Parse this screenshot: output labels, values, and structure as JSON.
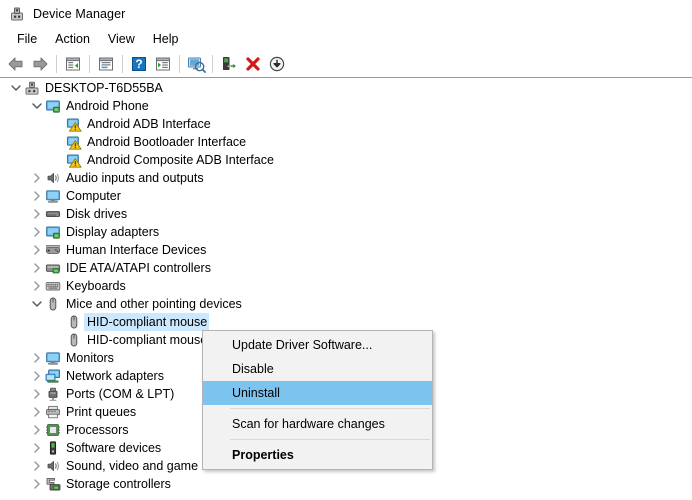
{
  "window": {
    "title": "Device Manager",
    "icon": "device-manager-icon"
  },
  "menubar": {
    "items": [
      {
        "label": "File"
      },
      {
        "label": "Action"
      },
      {
        "label": "View"
      },
      {
        "label": "Help"
      }
    ]
  },
  "toolbar": {
    "buttons": [
      {
        "name": "back-icon",
        "tooltip": "Back"
      },
      {
        "name": "forward-icon",
        "tooltip": "Forward"
      },
      {
        "name": "separator-1"
      },
      {
        "name": "show-hide-console-tree-icon",
        "tooltip": "Show/Hide Console Tree"
      },
      {
        "name": "separator-2"
      },
      {
        "name": "properties-icon",
        "tooltip": "Properties"
      },
      {
        "name": "separator-3"
      },
      {
        "name": "help-icon",
        "tooltip": "Help"
      },
      {
        "name": "view-icon",
        "tooltip": "View"
      },
      {
        "name": "separator-4"
      },
      {
        "name": "scan-for-hardware-changes-icon",
        "tooltip": "Scan for hardware changes"
      },
      {
        "name": "separator-5"
      },
      {
        "name": "update-driver-icon",
        "tooltip": "Update Driver Software"
      },
      {
        "name": "uninstall-icon",
        "tooltip": "Uninstall"
      },
      {
        "name": "disable-icon",
        "tooltip": "Disable"
      }
    ]
  },
  "tree": {
    "rows": [
      {
        "label": "DESKTOP-T6D55BA",
        "indent": 0,
        "state": "expanded",
        "icon": "computer-node-icon",
        "selected": false
      },
      {
        "label": "Android Phone",
        "indent": 1,
        "state": "expanded",
        "icon": "display-adapter-icon",
        "selected": false
      },
      {
        "label": "Android ADB Interface",
        "indent": 2,
        "state": "leaf",
        "icon": "warning-device-icon",
        "selected": false
      },
      {
        "label": "Android Bootloader Interface",
        "indent": 2,
        "state": "leaf",
        "icon": "warning-device-icon",
        "selected": false
      },
      {
        "label": "Android Composite ADB Interface",
        "indent": 2,
        "state": "leaf",
        "icon": "warning-device-icon",
        "selected": false
      },
      {
        "label": "Audio inputs and outputs",
        "indent": 1,
        "state": "collapsed",
        "icon": "speaker-icon",
        "selected": false
      },
      {
        "label": "Computer",
        "indent": 1,
        "state": "collapsed",
        "icon": "monitor-icon",
        "selected": false
      },
      {
        "label": "Disk drives",
        "indent": 1,
        "state": "collapsed",
        "icon": "disk-drive-icon",
        "selected": false
      },
      {
        "label": "Display adapters",
        "indent": 1,
        "state": "collapsed",
        "icon": "display-adapter-icon",
        "selected": false
      },
      {
        "label": "Human Interface Devices",
        "indent": 1,
        "state": "collapsed",
        "icon": "gamepad-icon",
        "selected": false
      },
      {
        "label": "IDE ATA/ATAPI controllers",
        "indent": 1,
        "state": "collapsed",
        "icon": "ide-controller-icon",
        "selected": false
      },
      {
        "label": "Keyboards",
        "indent": 1,
        "state": "collapsed",
        "icon": "keyboard-icon",
        "selected": false
      },
      {
        "label": "Mice and other pointing devices",
        "indent": 1,
        "state": "expanded",
        "icon": "mouse-icon",
        "selected": false
      },
      {
        "label": "HID-compliant mouse",
        "indent": 2,
        "state": "leaf",
        "icon": "mouse-icon",
        "selected": true
      },
      {
        "label": "HID-compliant mouse",
        "indent": 2,
        "state": "leaf",
        "icon": "mouse-icon",
        "selected": false
      },
      {
        "label": "Monitors",
        "indent": 1,
        "state": "collapsed",
        "icon": "monitor-icon",
        "selected": false
      },
      {
        "label": "Network adapters",
        "indent": 1,
        "state": "collapsed",
        "icon": "network-adapter-icon",
        "selected": false
      },
      {
        "label": "Ports (COM & LPT)",
        "indent": 1,
        "state": "collapsed",
        "icon": "port-icon",
        "selected": false
      },
      {
        "label": "Print queues",
        "indent": 1,
        "state": "collapsed",
        "icon": "printer-icon",
        "selected": false
      },
      {
        "label": "Processors",
        "indent": 1,
        "state": "collapsed",
        "icon": "processor-icon",
        "selected": false
      },
      {
        "label": "Software devices",
        "indent": 1,
        "state": "collapsed",
        "icon": "software-device-icon",
        "selected": false
      },
      {
        "label": "Sound, video and game controllers",
        "indent": 1,
        "state": "collapsed",
        "icon": "speaker-icon",
        "selected": false
      },
      {
        "label": "Storage controllers",
        "indent": 1,
        "state": "collapsed",
        "icon": "storage-controller-icon",
        "selected": false
      }
    ]
  },
  "context_menu": {
    "items": [
      {
        "label": "Update Driver Software...",
        "type": "item",
        "highlight": false,
        "bold": false
      },
      {
        "label": "Disable",
        "type": "item",
        "highlight": false,
        "bold": false
      },
      {
        "label": "Uninstall",
        "type": "item",
        "highlight": true,
        "bold": false
      },
      {
        "label": "",
        "type": "separator",
        "highlight": false,
        "bold": false
      },
      {
        "label": "Scan for hardware changes",
        "type": "item",
        "highlight": false,
        "bold": false
      },
      {
        "label": "",
        "type": "separator",
        "highlight": false,
        "bold": false
      },
      {
        "label": "Properties",
        "type": "item",
        "highlight": false,
        "bold": true
      }
    ]
  },
  "colors": {
    "selection_blue": "#cce8ff",
    "menu_highlight": "#7cc3f0",
    "menu_background": "#f2f2f2",
    "window_background": "#ffffff"
  }
}
